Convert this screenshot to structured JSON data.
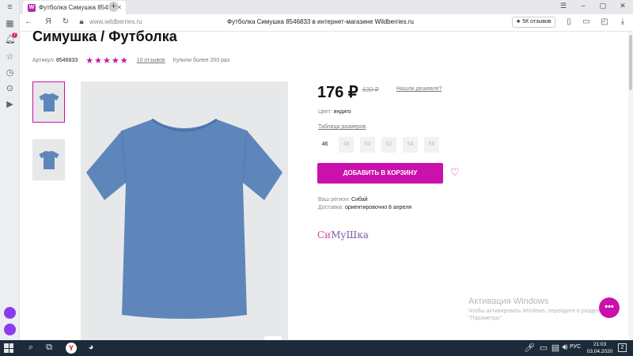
{
  "browser": {
    "tab_title": "Футболка Симушка 854…",
    "tab_favicon": "W",
    "tab_close": "✕",
    "new_tab": "+",
    "url": "www.wildberries.ru",
    "page_title": "Футболка Симушка 8546833 в интернет-магазине Wildberries.ru",
    "reviews_pill": "★ 5К отзывов",
    "left_rail_badge": "7"
  },
  "product": {
    "title": "Симушка / Футболка",
    "article_label": "Артикул:",
    "article_value": "8546833",
    "stars": "★★★★★",
    "reviews_link": "10 отзывов",
    "bought": "Купили более 200 раз",
    "price": "176 ₽",
    "old_price": "630 ₽",
    "cheaper_link": "Нашли дешевле?",
    "color_label": "Цвет:",
    "color_value": "индиго",
    "size_table_link": "Таблица размеров",
    "sizes": [
      "46",
      "48",
      "50",
      "52",
      "54",
      "56"
    ],
    "add_to_cart": "ДОБАВИТЬ В КОРЗИНУ",
    "region_label": "Ваш регион:",
    "region_value": "Сибай",
    "delivery_label": "Доставка:",
    "delivery_value": "ориентировочно 8 апреля",
    "brand_logo_a": "Си",
    "brand_logo_b": "МуШка"
  },
  "windows_activation": {
    "title": "Активация Windows",
    "subtitle": "Чтобы активировать Windows, перейдите в раздел \"Параметры\"."
  },
  "taskbar": {
    "lang": "РУС",
    "time": "21:03",
    "date": "03.04.2020",
    "notif_count": "2"
  },
  "colors": {
    "accent": "#cb11ab",
    "shirt": "#5e86bb",
    "taskbar": "#1c2a3a"
  }
}
